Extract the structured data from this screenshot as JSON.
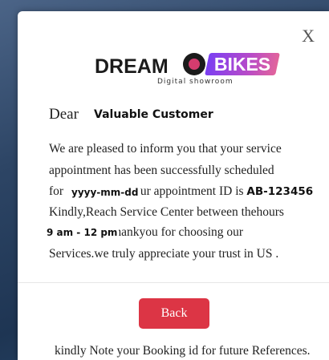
{
  "modal": {
    "close_label": "X",
    "logo": {
      "dream": "DREAM",
      "bikes": "BIKES",
      "subtitle": "Digital showroom"
    },
    "greeting": "Dear",
    "customer_name": "Valuable Customer",
    "message": {
      "line1": "We are pleased to inform you that your service",
      "line2": "appointment has been successfully scheduled",
      "line3_prefix": "for",
      "line3_mid": "ur appointment ID is",
      "date_placeholder": "yyyy-mm-dd",
      "appointment_id": "AB-123456",
      "line4": "Kindly,Reach Service Center between thehours",
      "time_range": "9 am - 12 pm",
      "line5_rest": ".Thankyou for choosing our",
      "line6": "Services.we truly appreciate your trust in US ."
    },
    "back_label": "Back",
    "footer_note": "kindly Note your Booking id for future References."
  },
  "colors": {
    "back_button": "#dc3545",
    "backdrop": "#2a3f5e"
  }
}
